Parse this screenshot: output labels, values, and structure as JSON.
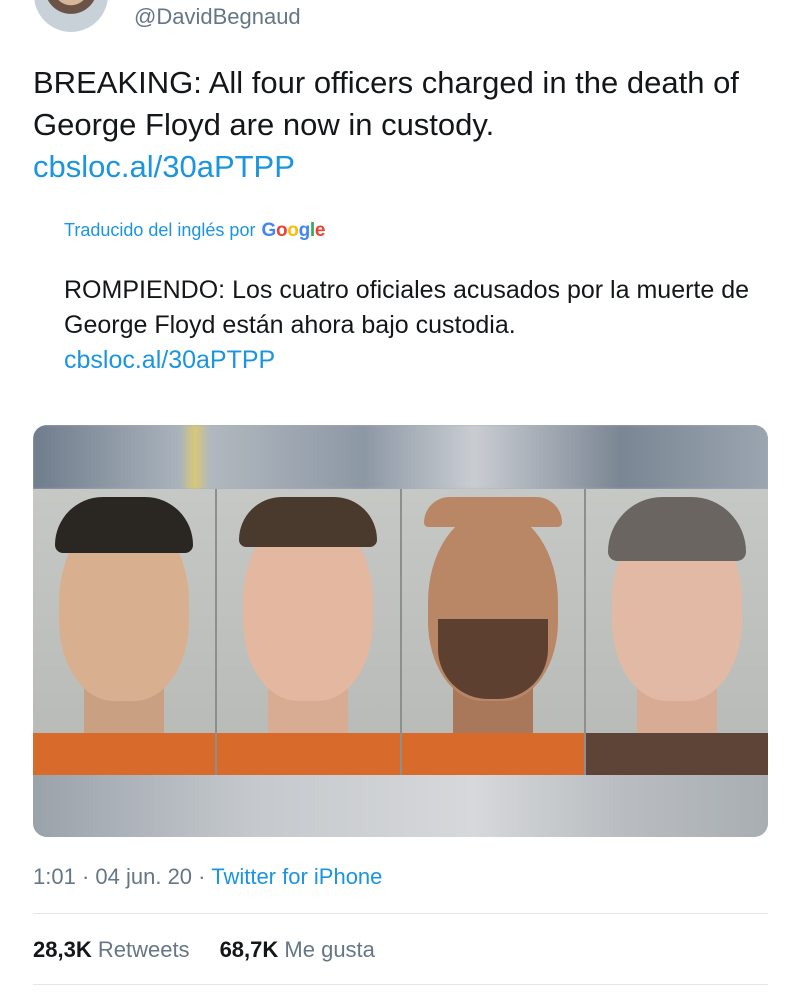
{
  "author": {
    "handle": "@DavidBegnaud"
  },
  "tweet": {
    "text": "BREAKING: All four officers charged in the death of George Floyd are now in custody.",
    "link": "cbsloc.al/30aPTPP"
  },
  "translation": {
    "label": "Traducido del inglés por",
    "provider": "Google",
    "text": "ROMPIENDO: Los cuatro oficiales acusados por la muerte de George Floyd están ahora bajo custodia.",
    "link": "cbsloc.al/30aPTPP"
  },
  "meta": {
    "time": "1:01",
    "separator": "·",
    "date": "04 jun. 20",
    "source": "Twitter for iPhone"
  },
  "stats": {
    "retweets_count": "28,3K",
    "retweets_label": "Retweets",
    "likes_count": "68,7K",
    "likes_label": "Me gusta"
  },
  "colors": {
    "link": "#1b95e0",
    "secondary_text": "#657786",
    "primary_text": "#14171a",
    "shirt": "#d86a2c"
  }
}
